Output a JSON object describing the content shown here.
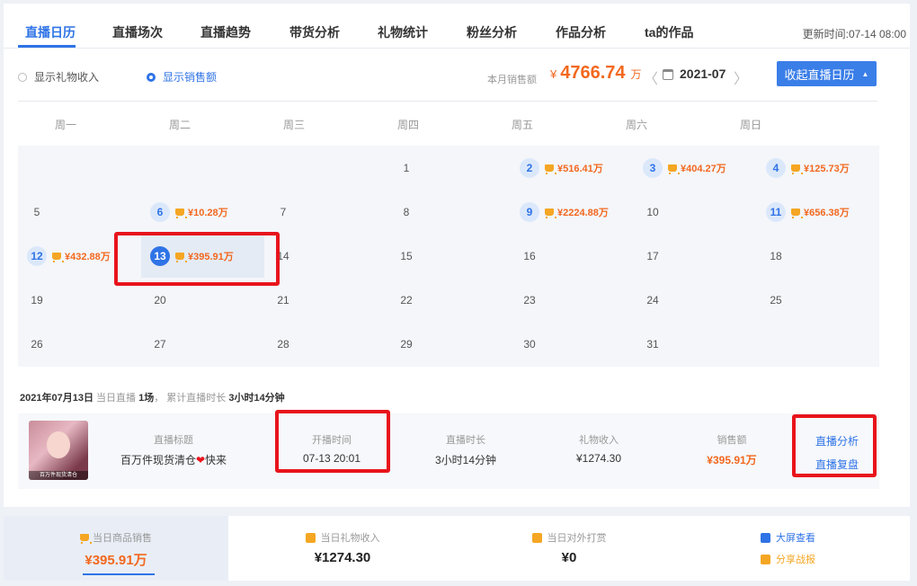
{
  "tabs": [
    {
      "label": "直播日历"
    },
    {
      "label": "直播场次"
    },
    {
      "label": "直播趋势"
    },
    {
      "label": "带货分析"
    },
    {
      "label": "礼物统计"
    },
    {
      "label": "粉丝分析"
    },
    {
      "label": "作品分析"
    },
    {
      "label": "ta的作品"
    }
  ],
  "update_time": "更新时间:07-14 08:00",
  "options": {
    "gift_income": "显示礼物收入",
    "sales": "显示销售额"
  },
  "month_total": {
    "label": "本月销售额",
    "currency": "¥",
    "value": "4766.74",
    "unit": "万"
  },
  "month_nav": {
    "prev": "〈",
    "next": "〉",
    "month": "2021-07"
  },
  "collapse_button": "收起直播日历",
  "weekdays": [
    "周一",
    "周二",
    "周三",
    "周四",
    "周五",
    "周六",
    "周日"
  ],
  "calendar": {
    "days": [
      {
        "day": "1",
        "sale": ""
      },
      {
        "day": "2",
        "sale": "¥516.41万"
      },
      {
        "day": "3",
        "sale": "¥404.27万"
      },
      {
        "day": "4",
        "sale": "¥125.73万"
      },
      {
        "day": "5",
        "sale": ""
      },
      {
        "day": "6",
        "sale": "¥10.28万"
      },
      {
        "day": "7",
        "sale": ""
      },
      {
        "day": "8",
        "sale": ""
      },
      {
        "day": "9",
        "sale": "¥2224.88万"
      },
      {
        "day": "10",
        "sale": ""
      },
      {
        "day": "11",
        "sale": "¥656.38万"
      },
      {
        "day": "12",
        "sale": "¥432.88万"
      },
      {
        "day": "13",
        "sale": "¥395.91万"
      },
      {
        "day": "14",
        "sale": ""
      },
      {
        "day": "15",
        "sale": ""
      },
      {
        "day": "16",
        "sale": ""
      },
      {
        "day": "17",
        "sale": ""
      },
      {
        "day": "18",
        "sale": ""
      },
      {
        "day": "19",
        "sale": ""
      },
      {
        "day": "20",
        "sale": ""
      },
      {
        "day": "21",
        "sale": ""
      },
      {
        "day": "22",
        "sale": ""
      },
      {
        "day": "23",
        "sale": ""
      },
      {
        "day": "24",
        "sale": ""
      },
      {
        "day": "25",
        "sale": ""
      },
      {
        "day": "26",
        "sale": ""
      },
      {
        "day": "27",
        "sale": ""
      },
      {
        "day": "28",
        "sale": ""
      },
      {
        "day": "29",
        "sale": ""
      },
      {
        "day": "30",
        "sale": ""
      },
      {
        "day": "31",
        "sale": ""
      }
    ]
  },
  "day_summary": {
    "date": "2021年07月13日",
    "live_label": "当日直播",
    "live_count": "1场",
    "sep": "，",
    "duration_label": "累计直播时长",
    "duration": "3小时14分钟"
  },
  "live": {
    "thumb_caption": "百万件现货清仓",
    "title_head": "直播标题",
    "title_text": "百万件现货清仓",
    "title_heart": "❤",
    "title_tail": "快来",
    "start_head": "开播时间",
    "start_val": "07-13 20:01",
    "duration_head": "直播时长",
    "duration_val": "3小时14分钟",
    "gift_head": "礼物收入",
    "gift_val": "¥1274.30",
    "sales_head": "销售额",
    "sales_val": "¥395.91万",
    "analysis_link": "直播分析",
    "review_link": "直播复盘"
  },
  "bottom": {
    "goods_sales_label": "当日商品销售",
    "goods_sales_value": "¥395.91万",
    "gift_label": "当日礼物收入",
    "gift_value": "¥1274.30",
    "tip_label": "当日对外打赏",
    "tip_value": "¥0",
    "big_screen": "大屏查看",
    "share": "分享战报"
  },
  "colors": {
    "accent": "#2f73e6",
    "sales_orange": "#f2681f",
    "highlight_red": "#e8141c"
  }
}
